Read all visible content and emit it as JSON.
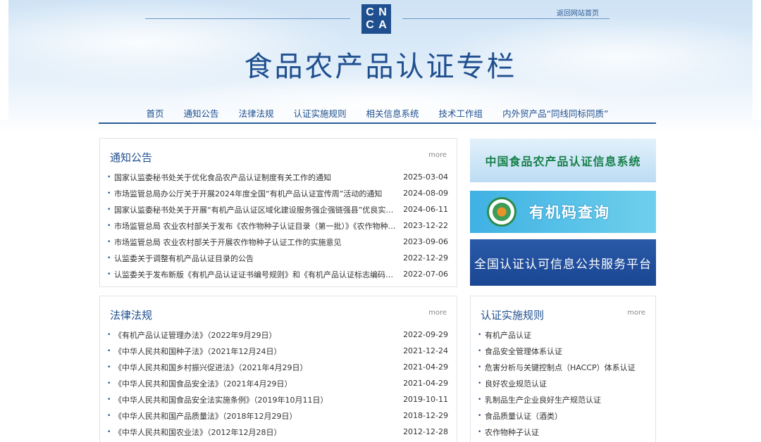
{
  "header": {
    "logo_letters": [
      "C",
      "N",
      "C",
      "A"
    ],
    "back_link": "返回网站首页",
    "title": "食品农产品认证专栏"
  },
  "nav": [
    {
      "label": "首页"
    },
    {
      "label": "通知公告"
    },
    {
      "label": "法律法规"
    },
    {
      "label": "认证实施规则"
    },
    {
      "label": "相关信息系统"
    },
    {
      "label": "技术工作组"
    },
    {
      "label": "内外贸产品“同线同标同质”"
    }
  ],
  "notices": {
    "title": "通知公告",
    "more": "more",
    "items": [
      {
        "text": "国家认监委秘书处关于优化食品农产品认证制度有关工作的通知",
        "date": "2025-03-04"
      },
      {
        "text": "市场监管总局办公厅关于开展2024年度全国“有机产品认证宣传周”活动的通知",
        "date": "2024-08-09"
      },
      {
        "text": "国家认监委秘书处关于开展“有机产品认证区域化建设服务强企强链强县”优良实践...",
        "date": "2024-06-11"
      },
      {
        "text": "市场监管总局 农业农村部关于发布《农作物种子认证目录（第一批）》《农作物种子...",
        "date": "2023-12-22"
      },
      {
        "text": "市场监管总局 农业农村部关于开展农作物种子认证工作的实施意见",
        "date": "2023-09-06"
      },
      {
        "text": "认监委关于调整有机产品认证目录的公告",
        "date": "2022-12-29"
      },
      {
        "text": "认监委关于发布新版《有机产品认证证书编号规则》和《有机产品认证标志编码规则...",
        "date": "2022-07-06"
      }
    ]
  },
  "laws": {
    "title": "法律法规",
    "more": "more",
    "items": [
      {
        "text": "《有机产品认证管理办法》（2022年9月29日）",
        "date": "2022-09-29"
      },
      {
        "text": "《中华人民共和国种子法》（2021年12月24日）",
        "date": "2021-12-24"
      },
      {
        "text": "《中华人民共和国乡村振兴促进法》（2021年4月29日）",
        "date": "2021-04-29"
      },
      {
        "text": "《中华人民共和国食品安全法》（2021年4月29日）",
        "date": "2021-04-29"
      },
      {
        "text": "《中华人民共和国食品安全法实施条例》（2019年10月11日）",
        "date": "2019-10-11"
      },
      {
        "text": "《中华人民共和国产品质量法》（2018年12月29日）",
        "date": "2018-12-29"
      },
      {
        "text": "《中华人民共和国农业法》（2012年12月28日）",
        "date": "2012-12-28"
      }
    ]
  },
  "banners": {
    "info_system": "中国食品农产品认证信息系统",
    "organic_code": "有机码查询",
    "public_platform": "全国认证认可信息公共服务平台"
  },
  "rules": {
    "title": "认证实施规则",
    "more": "more",
    "items": [
      {
        "text": "有机产品认证"
      },
      {
        "text": "食品安全管理体系认证"
      },
      {
        "text": "危害分析与关键控制点（HACCP）体系认证"
      },
      {
        "text": "良好农业规范认证"
      },
      {
        "text": "乳制品生产企业良好生产规范认证"
      },
      {
        "text": "食品质量认证（酒类）"
      },
      {
        "text": "农作物种子认证"
      }
    ]
  },
  "colors": {
    "brand_blue": "#1f4f8f",
    "green_title": "#17804a"
  }
}
